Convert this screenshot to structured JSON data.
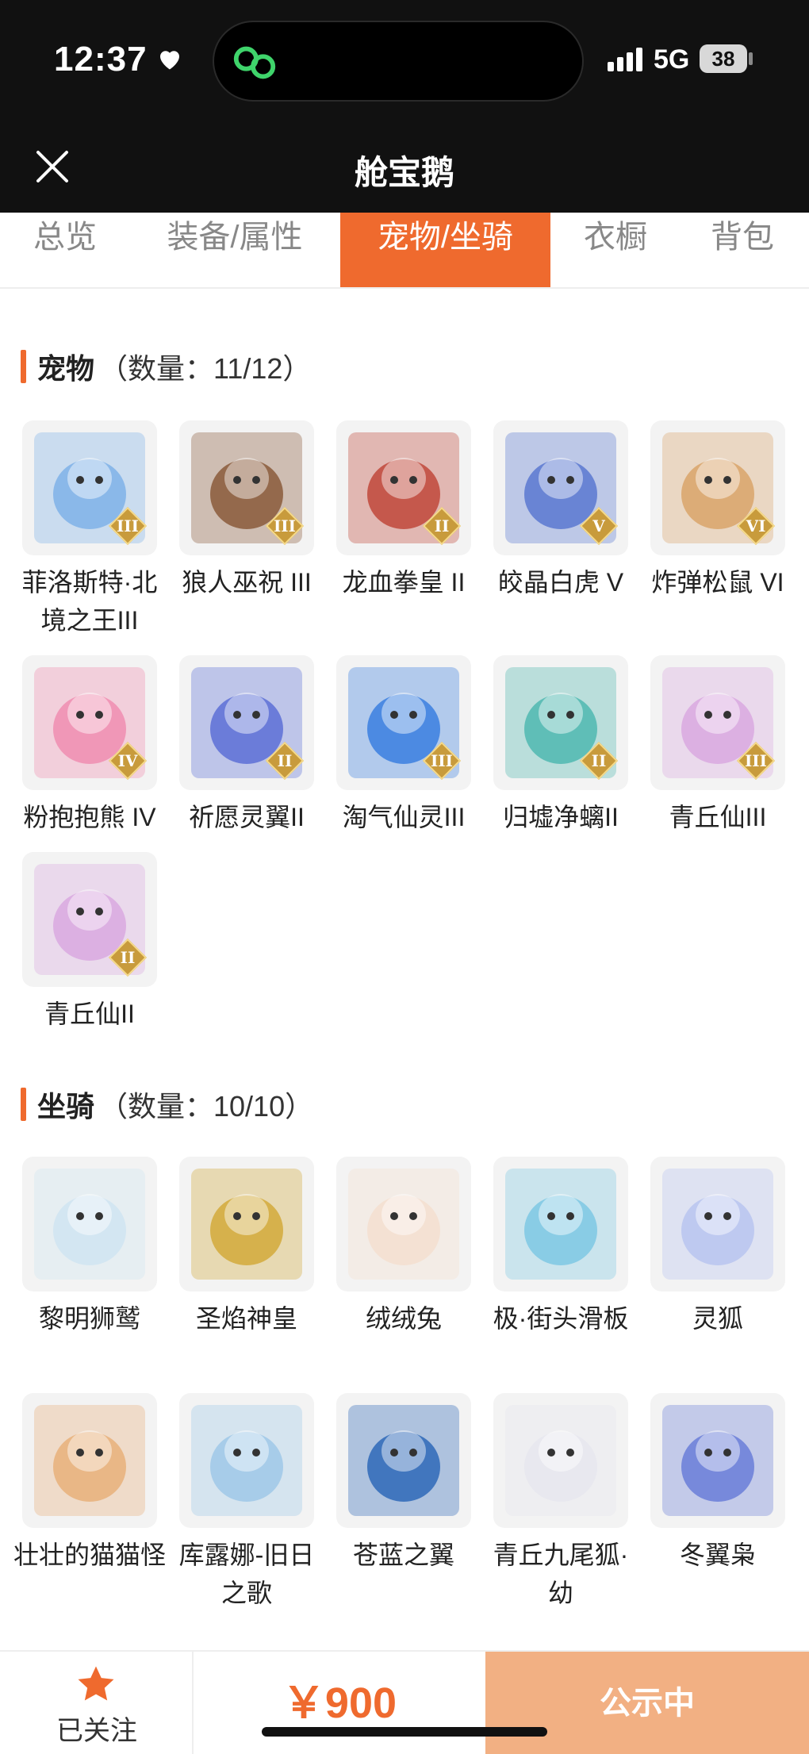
{
  "status_bar": {
    "time": "12:37",
    "network": "5G",
    "battery": "38"
  },
  "nav": {
    "title": "舱宝鹅"
  },
  "tabs": [
    {
      "label": "总览",
      "active": false
    },
    {
      "label": "装备/属性",
      "active": false
    },
    {
      "label": "宠物/坐骑",
      "active": true
    },
    {
      "label": "衣橱",
      "active": false
    },
    {
      "label": "背包",
      "active": false
    }
  ],
  "pets": {
    "title": "宠物",
    "count": "（数量：11/12）",
    "items": [
      {
        "label": "菲洛斯特·北境之王III",
        "badge": "III",
        "icon": "white-beast-icon",
        "color": "#7fb2e8"
      },
      {
        "label": "狼人巫祝 III",
        "badge": "III",
        "icon": "wolf-shaman-icon",
        "color": "#8a5a3a"
      },
      {
        "label": "龙血拳皇 II",
        "badge": "II",
        "icon": "red-beast-icon",
        "color": "#c0483a"
      },
      {
        "label": "皎晶白虎 V",
        "badge": "V",
        "icon": "white-tiger-icon",
        "color": "#5a78d0"
      },
      {
        "label": "炸弹松鼠 VI",
        "badge": "VI",
        "icon": "squirrel-icon",
        "color": "#d9a46a"
      },
      {
        "label": "粉抱抱熊 IV",
        "badge": "IV",
        "icon": "pink-bear-icon",
        "color": "#f08db0"
      },
      {
        "label": "祈愿灵翼II",
        "badge": "II",
        "icon": "griffin-icon",
        "color": "#5d6fd6"
      },
      {
        "label": "淘气仙灵III",
        "badge": "III",
        "icon": "blue-puppy-icon",
        "color": "#3a7fe0"
      },
      {
        "label": "归墟净螭II",
        "badge": "II",
        "icon": "teal-dragon-icon",
        "color": "#4fb8b0"
      },
      {
        "label": "青丘仙III",
        "badge": "III",
        "icon": "fox-fairy-icon",
        "color": "#d9a8e0"
      },
      {
        "label": "青丘仙II",
        "badge": "II",
        "icon": "fox-fairy-icon",
        "color": "#d9a8e0"
      }
    ]
  },
  "mounts": {
    "title": "坐骑",
    "count": "（数量：10/10）",
    "items": [
      {
        "label": "黎明狮鹫",
        "icon": "white-griffin-icon",
        "color": "#cfe4f2"
      },
      {
        "label": "圣焰神皇",
        "icon": "golden-phoenix-icon",
        "color": "#d2a93a"
      },
      {
        "label": "绒绒兔",
        "icon": "rabbit-icon",
        "color": "#f3dfcf"
      },
      {
        "label": "极·街头滑板",
        "icon": "skateboard-icon",
        "color": "#7ec8e3"
      },
      {
        "label": "灵狐",
        "icon": "spirit-fox-icon",
        "color": "#b8c4f0"
      },
      {
        "label": "壮壮的猫猫怪",
        "icon": "cat-icon",
        "color": "#e8b07a"
      },
      {
        "label": "库露娜-旧日之歌",
        "icon": "sheep-girl-icon",
        "color": "#9fc8e8"
      },
      {
        "label": "苍蓝之翼",
        "icon": "blue-dragon-icon",
        "color": "#2e68b8"
      },
      {
        "label": "青丘九尾狐·幼",
        "icon": "nine-tail-fox-icon",
        "color": "#e6e6ee"
      },
      {
        "label": "冬翼枭",
        "icon": "owl-icon",
        "color": "#6a7ed8"
      }
    ]
  },
  "bottom": {
    "follow_label": "已关注",
    "price": "￥900",
    "status_label": "公示中"
  },
  "colors": {
    "accent": "#ef6a2e",
    "status_btn": "#f2b083",
    "header": "#111111"
  }
}
